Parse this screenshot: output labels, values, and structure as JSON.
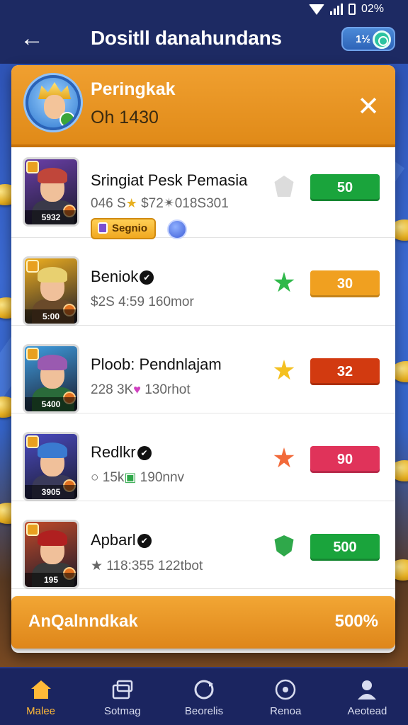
{
  "status_bar": {
    "battery": "02%"
  },
  "header": {
    "title": "Dositll danahundans",
    "badge": "1½"
  },
  "panel": {
    "label": "Peringkak",
    "value": "Oh 1430",
    "close_icon": "close-icon"
  },
  "rows": [
    {
      "name": "Sringiat Pesk Pemasia",
      "meta_a": "046 S",
      "meta_glyph": "★",
      "meta_b": " $72✴018S301",
      "tag": "5932",
      "chip": "Segnio",
      "score": "50",
      "score_color": "#1aa43c",
      "rank_color": "#dcdcdc",
      "rank_shape": "gem",
      "palette": [
        "#6a3fa8",
        "#c0463a",
        "#3a3a4a"
      ]
    },
    {
      "name": "Beniok",
      "verified": "✔",
      "meta_a": "$2S 4:59",
      "meta_glyph": "",
      "meta_b": " 160mor",
      "tag": "5:00",
      "score": "30",
      "score_color": "#f0a020",
      "rank_color": "#2fb84a",
      "rank_shape": "star",
      "palette": [
        "#f0b020",
        "#e8d070",
        "#6a4a2a"
      ]
    },
    {
      "name": "Ploob: Pendnlajam",
      "meta_a": "228 3K",
      "meta_glyph": "♥",
      "meta_b": " 130rhot",
      "tag": "5400",
      "score": "32",
      "score_color": "#d23a10",
      "rank_color": "#f4c020",
      "rank_shape": "star",
      "palette": [
        "#3f9de0",
        "#9a5ab0",
        "#2a6a3a"
      ]
    },
    {
      "name": "Redlkr",
      "verified": "✔",
      "meta_a": "○ 15k",
      "meta_glyph": "▣",
      "meta_b": " 190nnv",
      "tag": "3905",
      "score": "90",
      "score_color": "#e0335a",
      "rank_color": "#f26a3a",
      "rank_shape": "star",
      "palette": [
        "#4a4ac0",
        "#3a7ad0",
        "#3a3a5a"
      ]
    },
    {
      "name": "Apbarl",
      "verified": "✔",
      "meta_a": "★ 118:355",
      "meta_glyph": "",
      "meta_b": " 122tbot",
      "tag": "195",
      "score": "500",
      "score_color": "#1aa43c",
      "rank_color": "#2fa84a",
      "rank_shape": "shield",
      "palette": [
        "#c04a2a",
        "#b02020",
        "#3a3a3a"
      ]
    }
  ],
  "footer": {
    "label": "AnQalnndkak",
    "value": "500%"
  },
  "nav": [
    {
      "label": "Malee",
      "icon": "home-icon",
      "active": true
    },
    {
      "label": "Sotmag",
      "icon": "cards-icon"
    },
    {
      "label": "Beorelis",
      "icon": "refresh-icon"
    },
    {
      "label": "Renoa",
      "icon": "compass-icon"
    },
    {
      "label": "Aeotead",
      "icon": "profile-icon"
    }
  ],
  "colors": {
    "accent": "#e8931e",
    "nav_bg": "#1b2560",
    "active": "#ffb938"
  }
}
